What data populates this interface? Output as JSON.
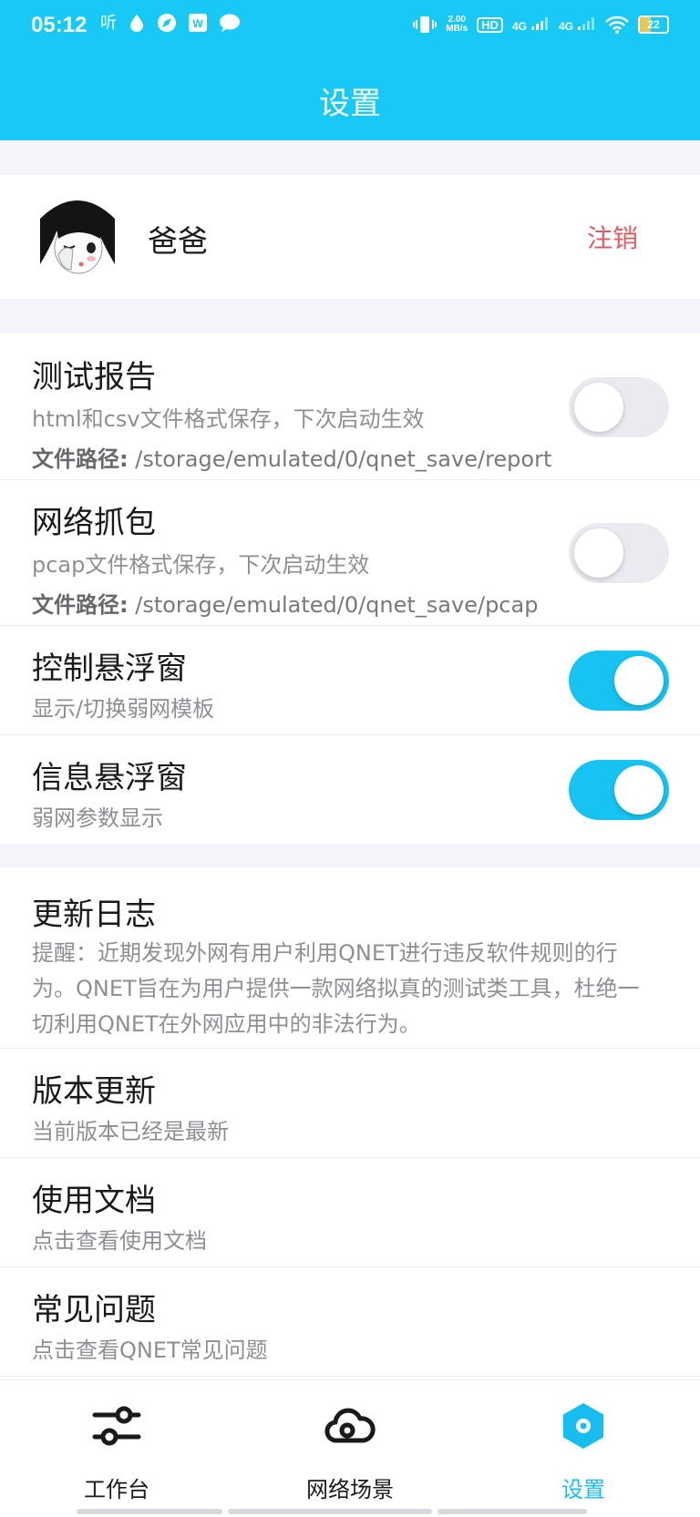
{
  "status_bar": {
    "time": "05:12",
    "left_icons": [
      "听",
      "drop-icon",
      "compass-icon",
      "wps-icon",
      "chat-icon"
    ],
    "speed_value": "2.00",
    "speed_unit": "MB/s",
    "hd": "HD",
    "net1": "4G",
    "net2": "4G",
    "battery": "22"
  },
  "header": {
    "title": "设置"
  },
  "profile": {
    "name": "爸爸",
    "logout_label": "注销"
  },
  "settings": [
    {
      "title": "测试报告",
      "subtitle": "html和csv文件格式保存，下次启动生效",
      "path_label": "文件路径:",
      "path_value": "/storage/emulated/0/qnet_save/report",
      "enabled": false
    },
    {
      "title": "网络抓包",
      "subtitle": "pcap文件格式保存，下次启动生效",
      "path_label": "文件路径:",
      "path_value": "/storage/emulated/0/qnet_save/pcap",
      "enabled": false
    },
    {
      "title": "控制悬浮窗",
      "subtitle": "显示/切换弱网模板",
      "enabled": true
    },
    {
      "title": "信息悬浮窗",
      "subtitle": "弱网参数显示",
      "enabled": true
    }
  ],
  "info": {
    "changelog_title": "更新日志",
    "changelog_notice": "提醒：近期发现外网有用户利用QNET进行违反软件规则的行为。QNET旨在为用户提供一款网络拟真的测试类工具，杜绝一切利用QNET在外网应用中的非法行为。",
    "version_title": "版本更新",
    "version_sub": "当前版本已经是最新",
    "docs_title": "使用文档",
    "docs_sub": "点击查看使用文档",
    "faq_title": "常见问题",
    "faq_sub": "点击查看QNET常见问题"
  },
  "tabs": [
    {
      "label": "工作台",
      "icon": "sliders-icon",
      "active": false
    },
    {
      "label": "网络场景",
      "icon": "cloud-icon",
      "active": false
    },
    {
      "label": "设置",
      "icon": "hexagon-settings-icon",
      "active": true
    }
  ],
  "colors": {
    "accent": "#17CAF5",
    "logout": "#E05A63",
    "toggle_on": "#17C3F0"
  }
}
